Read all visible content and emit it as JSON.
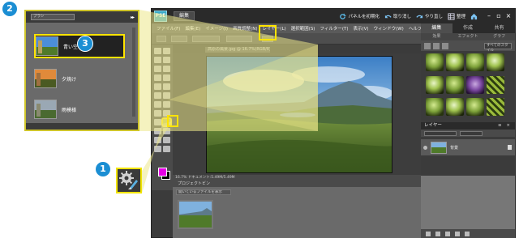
{
  "app": {
    "logo_text": "PSE",
    "mode_button": "編集",
    "actions": [
      {
        "icon": "refresh-icon",
        "label": "パネルを初期化"
      },
      {
        "icon": "undo-icon",
        "label": "取り消し"
      },
      {
        "icon": "redo-icon",
        "label": "やり直し"
      },
      {
        "icon": "organizer-icon",
        "label": "整理"
      },
      {
        "icon": "home-icon",
        "label": ""
      }
    ],
    "window_controls": [
      "–",
      "▫",
      "×"
    ]
  },
  "menu": [
    "ファイル(F)",
    "編集(E)",
    "イメージ(I)",
    "画質調整(N)",
    "レイヤー(L)",
    "選択範囲(S)",
    "フィルター(T)",
    "表示(V)",
    "ウィンドウ(W)",
    "ヘルプ(H)"
  ],
  "document": {
    "tab_title": "高原の風景.jpg @ 16.7%(RGB/8)",
    "status": "16.7%  ドキュメント:5.49M/5.49M"
  },
  "project_bin": {
    "header": "プロジェクトビン",
    "select": "開いているファイルを表示"
  },
  "panels": {
    "tabs": [
      "編集",
      "作成",
      "共有"
    ],
    "subtabs": [
      "効果",
      "エフェクト",
      "グラフ"
    ],
    "effects_select": "すべてのスタイル",
    "layers_header": "レイヤー",
    "layers_controls": "≡ ×",
    "layer_name": "背景"
  },
  "callout": {
    "select": "ブラシ",
    "items": [
      "青い空",
      "夕焼け",
      "雨模様"
    ]
  },
  "badges": [
    "1",
    "2",
    "3"
  ],
  "colors": {
    "highlight": "#ffe400",
    "badge": "#1b8ed3",
    "foreground": "#e600e6",
    "background": "#000000"
  }
}
